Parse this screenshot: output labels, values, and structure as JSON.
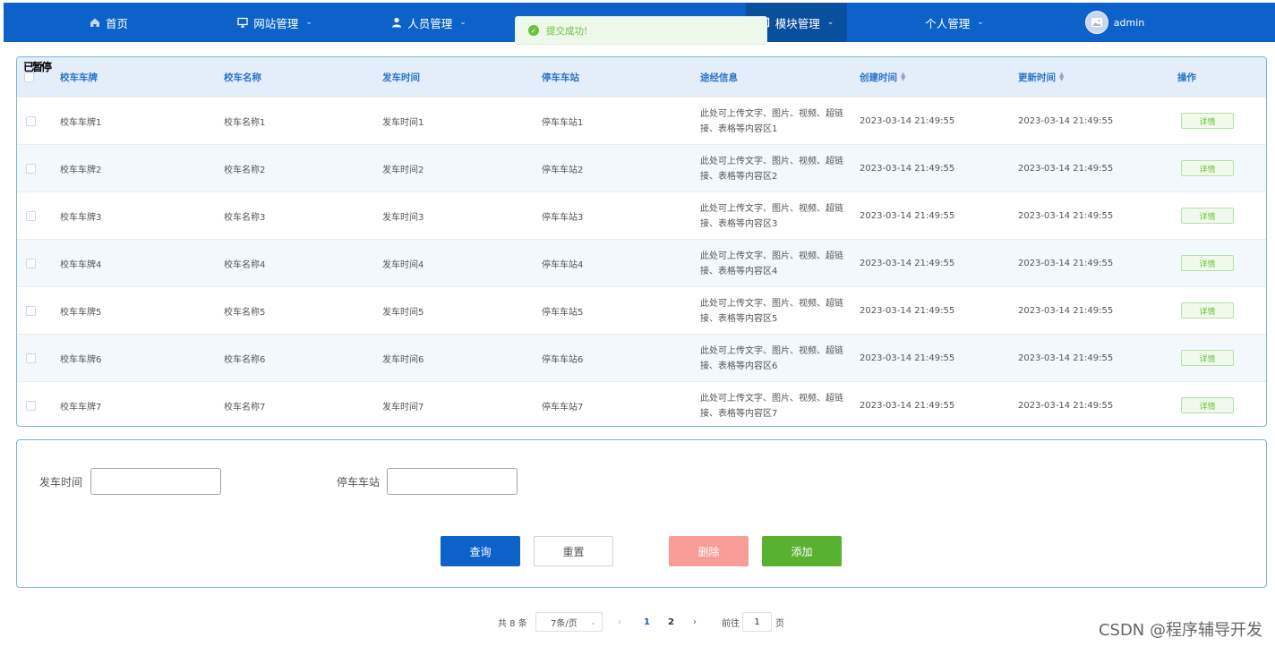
{
  "nav": {
    "items": [
      {
        "label": "首页",
        "icon": "home-icon"
      },
      {
        "label": "网站管理",
        "icon": "monitor-icon"
      },
      {
        "label": "人员管理",
        "icon": "user-icon"
      },
      {
        "label": "模块管理",
        "icon": "module-icon"
      },
      {
        "label": "个人管理",
        "icon": ""
      }
    ],
    "user": "admin"
  },
  "toast": {
    "message": "提交成功!"
  },
  "overlay_text": "已暂停",
  "table": {
    "headers": [
      "校车车牌",
      "校车名称",
      "发车时间",
      "停车车站",
      "途经信息",
      "创建时间",
      "更新时间",
      "操作"
    ],
    "rows": [
      {
        "plate": "校车车牌1",
        "name": "校车名称1",
        "depart": "发车时间1",
        "station": "停车车站1",
        "route": "此处可上传文字、图片、视频、超链接、表格等内容区1",
        "created": "2023-03-14 21:49:55",
        "updated": "2023-03-14 21:49:55",
        "action": "详情"
      },
      {
        "plate": "校车车牌2",
        "name": "校车名称2",
        "depart": "发车时间2",
        "station": "停车车站2",
        "route": "此处可上传文字、图片、视频、超链接、表格等内容区2",
        "created": "2023-03-14 21:49:55",
        "updated": "2023-03-14 21:49:55",
        "action": "详情"
      },
      {
        "plate": "校车车牌3",
        "name": "校车名称3",
        "depart": "发车时间3",
        "station": "停车车站3",
        "route": "此处可上传文字、图片、视频、超链接、表格等内容区3",
        "created": "2023-03-14 21:49:55",
        "updated": "2023-03-14 21:49:55",
        "action": "详情"
      },
      {
        "plate": "校车车牌4",
        "name": "校车名称4",
        "depart": "发车时间4",
        "station": "停车车站4",
        "route": "此处可上传文字、图片、视频、超链接、表格等内容区4",
        "created": "2023-03-14 21:49:55",
        "updated": "2023-03-14 21:49:55",
        "action": "详情"
      },
      {
        "plate": "校车车牌5",
        "name": "校车名称5",
        "depart": "发车时间5",
        "station": "停车车站5",
        "route": "此处可上传文字、图片、视频、超链接、表格等内容区5",
        "created": "2023-03-14 21:49:55",
        "updated": "2023-03-14 21:49:55",
        "action": "详情"
      },
      {
        "plate": "校车车牌6",
        "name": "校车名称6",
        "depart": "发车时间6",
        "station": "停车车站6",
        "route": "此处可上传文字、图片、视频、超链接、表格等内容区6",
        "created": "2023-03-14 21:49:55",
        "updated": "2023-03-14 21:49:55",
        "action": "详情"
      },
      {
        "plate": "校车车牌7",
        "name": "校车名称7",
        "depart": "发车时间7",
        "station": "停车车站7",
        "route": "此处可上传文字、图片、视频、超链接、表格等内容区7",
        "created": "2023-03-14 21:49:55",
        "updated": "2023-03-14 21:49:55",
        "action": "详情"
      }
    ]
  },
  "search": {
    "depart_label": "发车时间",
    "station_label": "停车车站",
    "query": "查询",
    "reset": "重置",
    "delete": "删除",
    "add": "添加"
  },
  "pagination": {
    "total": "共 8 条",
    "page_size": "7条/页",
    "pages": [
      "1",
      "2"
    ],
    "current_page": "1",
    "goto_label": "前往",
    "goto_value": "1",
    "page_suffix": "页"
  },
  "watermark": "CSDN @程序辅导开发"
}
